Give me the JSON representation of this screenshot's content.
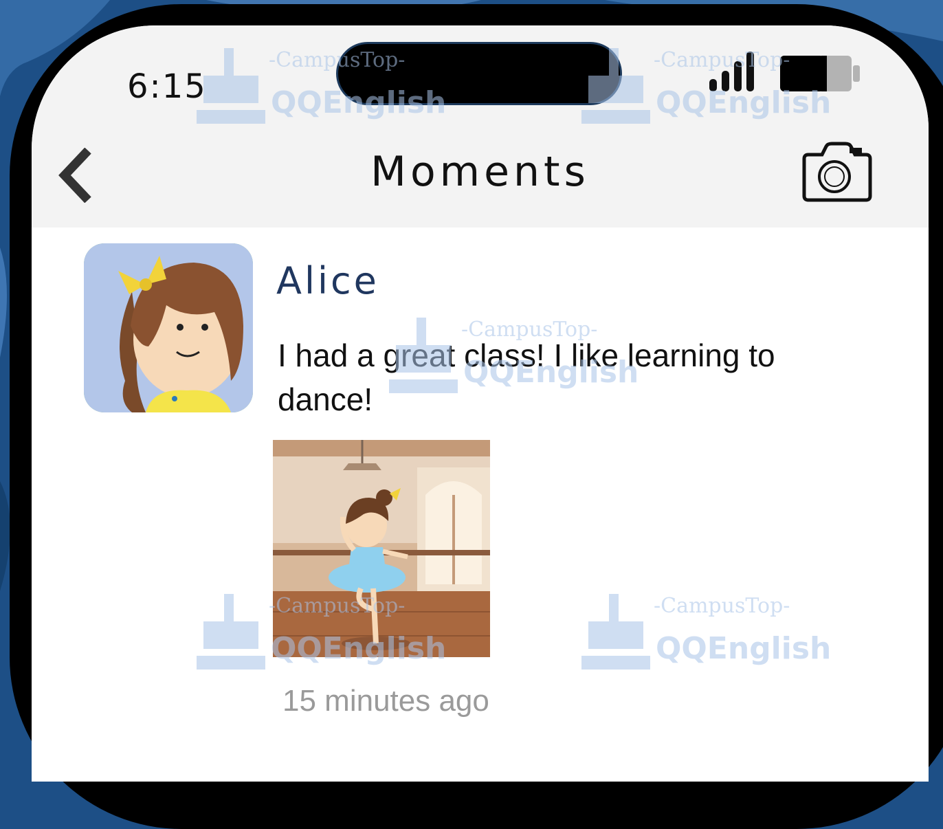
{
  "status_bar": {
    "time": "6:15"
  },
  "nav": {
    "title": "Moments"
  },
  "post": {
    "author": "Alice",
    "text": "I had a great class! I like learning to dance!",
    "timestamp": "15 minutes ago"
  },
  "watermark": {
    "line1": "-CampusTop-",
    "line2": "QQEnglish"
  },
  "icons": {
    "back": "chevron-left-icon",
    "camera": "camera-icon",
    "signal": "signal-icon",
    "battery": "battery-icon"
  },
  "colors": {
    "background": "#1d4f86",
    "author_name": "#20375f",
    "timestamp": "#9a9a9a",
    "watermark": "#a9c4e8"
  }
}
